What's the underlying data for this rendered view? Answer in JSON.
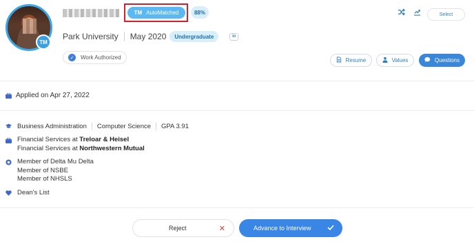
{
  "header": {
    "badge_logo": "TM",
    "automatched_label": "AutoMatched",
    "match_score": "88%",
    "select_label": "Select",
    "icons": [
      "shuffle-icon",
      "compare-icon",
      "download-icon"
    ]
  },
  "education": {
    "school": "Park University",
    "graduation": "May 2020",
    "level": "Undergraduate",
    "linkedin_label": "in"
  },
  "work_authorization": {
    "label": "Work Authorized"
  },
  "actions": {
    "resume_label": "Resume",
    "values_label": "Values",
    "questions_label": "Questions"
  },
  "applied": {
    "text": "Applied on Apr 27, 2022"
  },
  "details": {
    "majors": [
      "Business Administration",
      "Computer Science"
    ],
    "gpa": "GPA 3.91",
    "experience": [
      {
        "role": "Financial Services at ",
        "company": "Treloar & Heisel"
      },
      {
        "role": "Financial Services at ",
        "company": "Northwestern Mutual"
      }
    ],
    "organizations": [
      "Member of Delta Mu Delta",
      "Member of NSBE",
      "Member of NHSLS"
    ],
    "honors": "Dean's List"
  },
  "footer": {
    "reject_label": "Reject",
    "advance_label": "Advance to Interview"
  },
  "colors": {
    "accent": "#3a86e6",
    "badge": "#5bb8f2",
    "highlight": "#d0212b"
  }
}
